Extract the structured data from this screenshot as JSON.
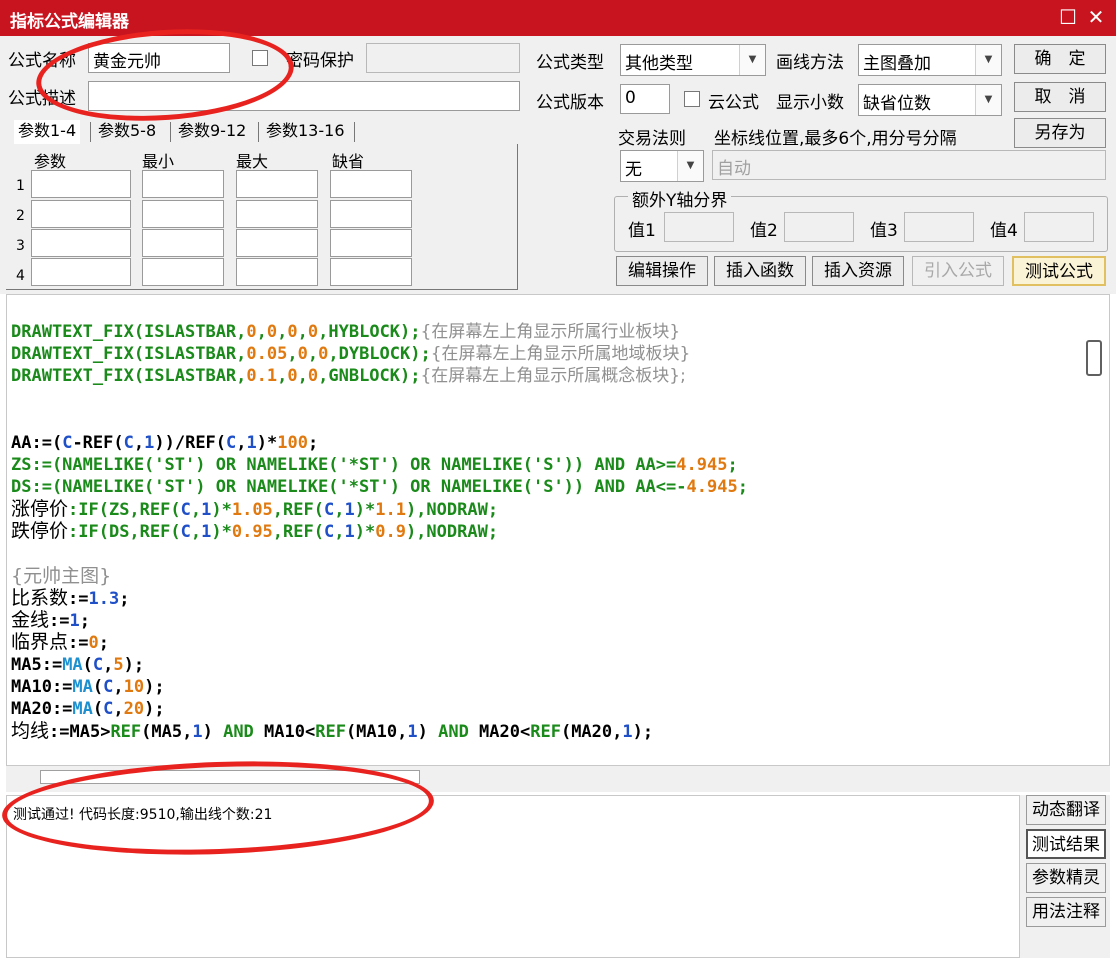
{
  "window": {
    "title": "指标公式编辑器"
  },
  "header": {
    "name_label": "公式名称",
    "name_value": "黄金元帅",
    "password_label": "密码保护",
    "desc_label": "公式描述",
    "desc_value": "",
    "type_label": "公式类型",
    "type_value": "其他类型",
    "draw_label": "画线方法",
    "draw_value": "主图叠加",
    "version_label": "公式版本",
    "version_value": "0",
    "cloud_label": "云公式",
    "decimals_label": "显示小数",
    "decimals_value": "缺省位数",
    "trade_rule_label": "交易法则",
    "trade_rule_value": "无",
    "coord_label": "坐标线位置,最多6个,用分号分隔",
    "coord_value": "自动",
    "axis_group_label": "额外Y轴分界",
    "axis_values": [
      "值1",
      "值2",
      "值3",
      "值4"
    ]
  },
  "buttons": {
    "ok": "确　定",
    "cancel": "取　消",
    "save_as": "另存为",
    "edit_ops": "编辑操作",
    "insert_func": "插入函数",
    "insert_res": "插入资源",
    "import_formula": "引入公式",
    "test_formula": "测试公式"
  },
  "params": {
    "tabs": [
      "参数1-4",
      "参数5-8",
      "参数9-12",
      "参数13-16"
    ],
    "headers": [
      "参数",
      "最小",
      "最大",
      "缺省"
    ],
    "rows": [
      "1",
      "2",
      "3",
      "4"
    ]
  },
  "code": {
    "l1a": "DRAWTEXT_FIX(ISLASTBAR,",
    "l1b": "0",
    "l1c": ",",
    "l1d": "0",
    "l1e": ",",
    "l1f": "0",
    "l1g": ",",
    "l1h": "0",
    "l1i": ",HYBLOCK);",
    "l1j": "{在屏幕左上角显示所属行业板块}",
    "l2a": "DRAWTEXT_FIX(ISLASTBAR,",
    "l2b": "0.05",
    "l2c": ",",
    "l2d": "0",
    "l2e": ",",
    "l2f": "0",
    "l2g": ",DYBLOCK);",
    "l2h": "{在屏幕左上角显示所属地域板块}",
    "l3a": "DRAWTEXT_FIX(ISLASTBAR,",
    "l3b": "0.1",
    "l3c": ",",
    "l3d": "0",
    "l3e": ",",
    "l3f": "0",
    "l3g": ",GNBLOCK);",
    "l3h": "{在屏幕左上角显示所属概念板块};",
    "l4a": "AA:=(",
    "l4b": "C",
    "l4c": "-REF(",
    "l4d": "C",
    "l4e": ",",
    "l4f": "1",
    "l4g": "))/REF(",
    "l4h": "C",
    "l4i": ",",
    "l4j": "1",
    "l4k": ")*",
    "l4l": "100",
    "l4m": ";",
    "l5a": "ZS:=(NAMELIKE('ST') OR NAMELIKE('*ST') OR NAMELIKE('S')) AND AA>=",
    "l5b": "4.945",
    "l5c": ";",
    "l6a": "DS:=(NAMELIKE('ST') OR NAMELIKE('*ST') OR NAMELIKE('S')) AND AA<=-",
    "l6b": "4.945",
    "l6c": ";",
    "l7a": "涨停价",
    "l7b": ":IF(ZS,REF(",
    "l7c": "C",
    "l7d": ",",
    "l7e": "1",
    "l7f": ")*",
    "l7g": "1.05",
    "l7h": ",REF(",
    "l7i": "C",
    "l7j": ",",
    "l7k": "1",
    "l7l": ")*",
    "l7m": "1.1",
    "l7n": "),NODRAW;",
    "l8a": "跌停价",
    "l8b": ":IF(DS,REF(",
    "l8c": "C",
    "l8d": ",",
    "l8e": "1",
    "l8f": ")*",
    "l8g": "0.95",
    "l8h": ",REF(",
    "l8i": "C",
    "l8j": ",",
    "l8k": "1",
    "l8l": ")*",
    "l8m": "0.9",
    "l8n": "),NODRAW;",
    "l9": "{元帅主图}",
    "l10a": "比系数",
    "l10b": ":=",
    "l10c": "1.3",
    "l10d": ";",
    "l11a": "金线",
    "l11b": ":=",
    "l11c": "1",
    "l11d": ";",
    "l12a": "临界点",
    "l12b": ":=",
    "l12c": "0",
    "l12d": ";",
    "l13a": "MA5:=",
    "l13b": "MA",
    "l13c": "(",
    "l13d": "C",
    "l13e": ",",
    "l13f": "5",
    "l13g": ");",
    "l14a": "MA10:=",
    "l14b": "MA",
    "l14c": "(",
    "l14d": "C",
    "l14e": ",",
    "l14f": "10",
    "l14g": ");",
    "l15a": "MA20:=",
    "l15b": "MA",
    "l15c": "(",
    "l15d": "C",
    "l15e": ",",
    "l15f": "20",
    "l15g": ");",
    "l16a": "均线",
    "l16b": ":=MA5>",
    "l16c": "REF",
    "l16d": "(MA5,",
    "l16e": "1",
    "l16f": ") ",
    "l16g": "AND",
    "l16h": " MA10<",
    "l16i": "REF",
    "l16j": "(MA10,",
    "l16k": "1",
    "l16l": ") ",
    "l16m": "AND",
    "l16n": " MA20<",
    "l16o": "REF",
    "l16p": "(MA20,",
    "l16q": "1",
    "l16r": ");"
  },
  "output": {
    "message": "测试通过! 代码长度:9510,输出线个数:21"
  },
  "side_buttons": [
    "动态翻译",
    "测试结果",
    "参数精灵",
    "用法注释"
  ],
  "colors": {
    "title_bar": "#c8141e",
    "annotation": "#e8231f",
    "keyword": "#1a8a1a",
    "number": "#e07a10",
    "function": "#1e90d0"
  }
}
